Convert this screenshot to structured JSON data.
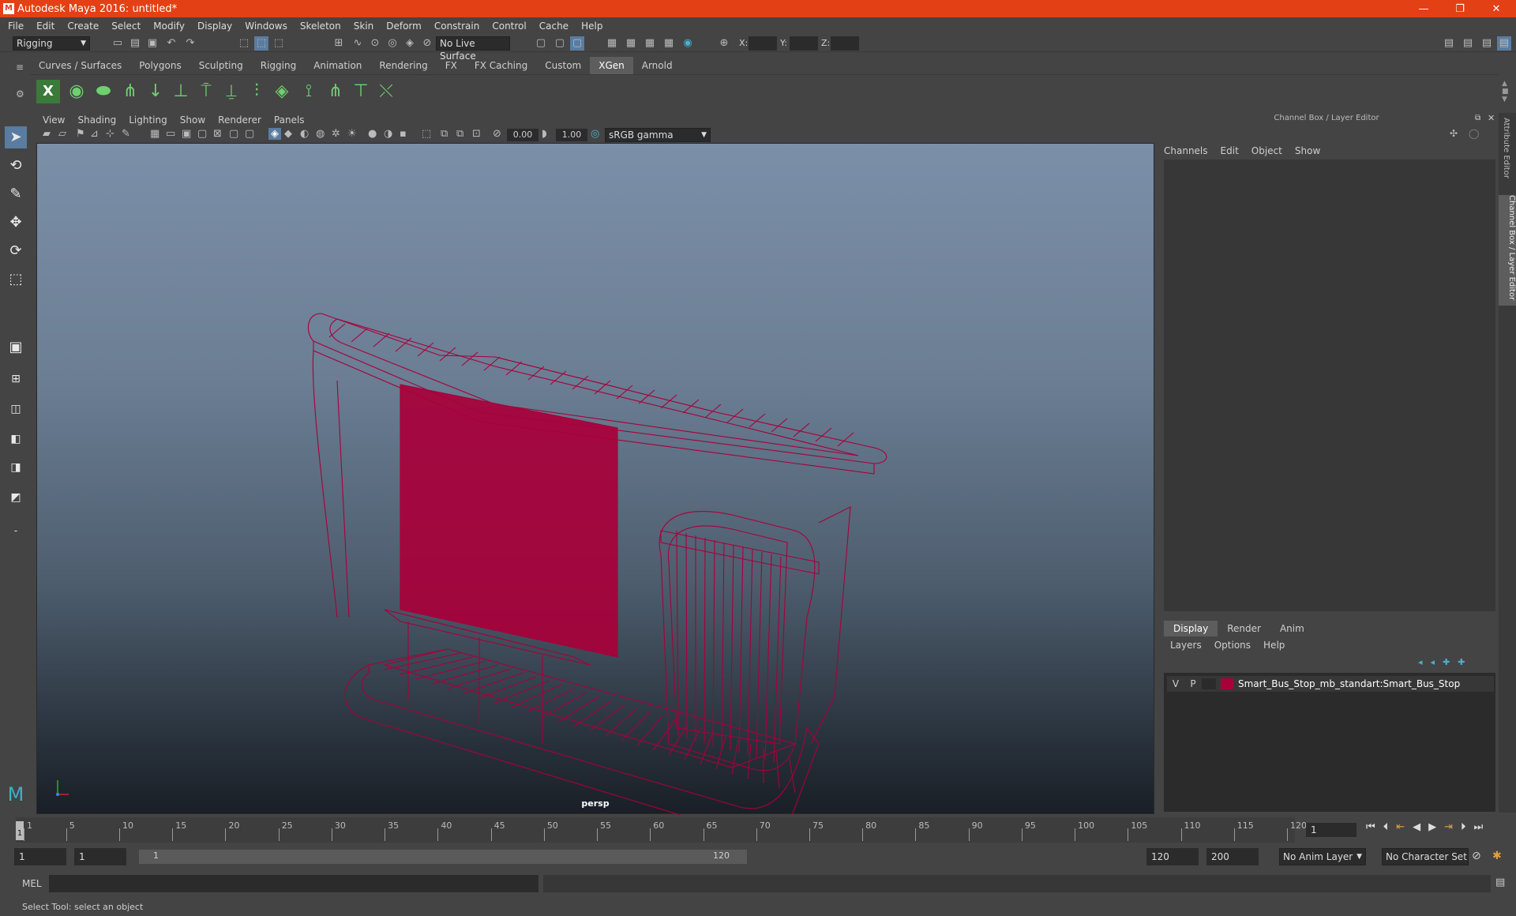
{
  "window": {
    "title": "Autodesk Maya 2016: untitled*",
    "controls": [
      "—",
      "❐",
      "✕"
    ]
  },
  "menubar": [
    "File",
    "Edit",
    "Create",
    "Select",
    "Modify",
    "Display",
    "Windows",
    "Skeleton",
    "Skin",
    "Deform",
    "Constrain",
    "Control",
    "Cache",
    "Help"
  ],
  "statusline": {
    "mode": "Rigging",
    "live_surface": "No Live Surface",
    "x_label": "X:",
    "y_label": "Y:",
    "z_label": "Z:"
  },
  "shelf_tabs": [
    "Curves / Surfaces",
    "Polygons",
    "Sculpting",
    "Rigging",
    "Animation",
    "Rendering",
    "FX",
    "FX Caching",
    "Custom",
    "XGen",
    "Arnold"
  ],
  "active_shelf_tab": "XGen",
  "viewport": {
    "menus": [
      "View",
      "Shading",
      "Lighting",
      "Show",
      "Renderer",
      "Panels"
    ],
    "exposure": "0.00",
    "gamma": "1.00",
    "color_space": "sRGB gamma",
    "camera_label": "persp",
    "wire_color": "#a8003a"
  },
  "channel_box": {
    "title": "Channel Box / Layer Editor",
    "menus": [
      "Channels",
      "Edit",
      "Object",
      "Show"
    ]
  },
  "layer_editor": {
    "tabs": [
      "Display",
      "Render",
      "Anim"
    ],
    "active_tab": "Display",
    "menus": [
      "Layers",
      "Options",
      "Help"
    ],
    "layers": [
      {
        "visible": "V",
        "playback": "P",
        "color": "#a8003a",
        "name": "Smart_Bus_Stop_mb_standart:Smart_Bus_Stop"
      }
    ]
  },
  "side_tabs": [
    "Attribute Editor",
    "Channel Box / Layer Editor"
  ],
  "timeline": {
    "ticks": [
      "1",
      "5",
      "10",
      "15",
      "20",
      "25",
      "30",
      "35",
      "40",
      "45",
      "50",
      "55",
      "60",
      "65",
      "70",
      "75",
      "80",
      "85",
      "90",
      "95",
      "100",
      "105",
      "110",
      "115",
      "120"
    ],
    "current_frame": "1"
  },
  "range": {
    "start": "1",
    "start_inner": "1",
    "slider_start": "1",
    "slider_end": "120",
    "end_inner": "120",
    "end": "200",
    "anim_layer": "No Anim Layer",
    "character_set": "No Character Set"
  },
  "command_line": {
    "label": "MEL"
  },
  "help_line": "Select Tool: select an object"
}
